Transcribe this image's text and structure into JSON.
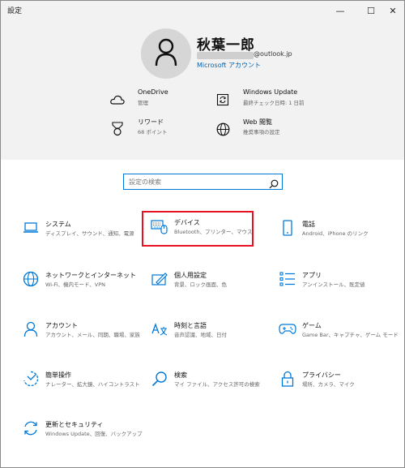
{
  "window": {
    "title": "設定",
    "minimize": "—",
    "maximize": "☐",
    "close": "✕"
  },
  "account": {
    "name": "秋葉一郎",
    "email": "@outlook.jp",
    "account_type": "Microsoft アカウント"
  },
  "header_items": [
    {
      "title": "OneDrive",
      "subtitle": "管理",
      "icon": "cloud-icon"
    },
    {
      "title": "Windows Update",
      "subtitle": "最終チェック日時: 1 日前",
      "icon": "sync-icon"
    },
    {
      "title": "リワード",
      "subtitle": "68 ポイント",
      "icon": "medal-icon"
    },
    {
      "title": "Web 閲覧",
      "subtitle": "推奨事項の設定",
      "icon": "globe-icon"
    }
  ],
  "search": {
    "placeholder": "設定の検索"
  },
  "categories": [
    {
      "title": "システム",
      "subtitle": "ディスプレイ、サウンド、通知、電源",
      "icon": "laptop-icon"
    },
    {
      "title": "デバイス",
      "subtitle": "Bluetooth、プリンター、マウス",
      "icon": "keyboard-icon"
    },
    {
      "title": "電話",
      "subtitle": "Android、iPhone のリンク",
      "icon": "phone-icon"
    },
    {
      "title": "ネットワークとインターネット",
      "subtitle": "Wi-Fi、機内モード、VPN",
      "icon": "globe-icon"
    },
    {
      "title": "個人用設定",
      "subtitle": "背景、ロック画面、色",
      "icon": "paint-icon"
    },
    {
      "title": "アプリ",
      "subtitle": "アンインストール、既定値",
      "icon": "apps-list-icon"
    },
    {
      "title": "アカウント",
      "subtitle": "アカウント、メール、同期、職場、家族",
      "icon": "person-icon"
    },
    {
      "title": "時刻と言語",
      "subtitle": "音声認識、地域、日付",
      "icon": "language-icon"
    },
    {
      "title": "ゲーム",
      "subtitle": "Game Bar、キャプチャ、ゲーム モード",
      "icon": "gamepad-icon"
    },
    {
      "title": "簡単操作",
      "subtitle": "ナレーター、拡大鏡、ハイコントラスト",
      "icon": "accessibility-icon"
    },
    {
      "title": "検索",
      "subtitle": "マイ ファイル、アクセス許可の検索",
      "icon": "search-icon"
    },
    {
      "title": "プライバシー",
      "subtitle": "場所、カメラ、マイク",
      "icon": "lock-icon"
    },
    {
      "title": "更新とセキュリティ",
      "subtitle": "Windows Update、回復、バックアップ",
      "icon": "update-icon"
    }
  ],
  "colors": {
    "accent": "#0078d7",
    "highlight": "#e81123",
    "header_bg": "#f2f2f2"
  }
}
